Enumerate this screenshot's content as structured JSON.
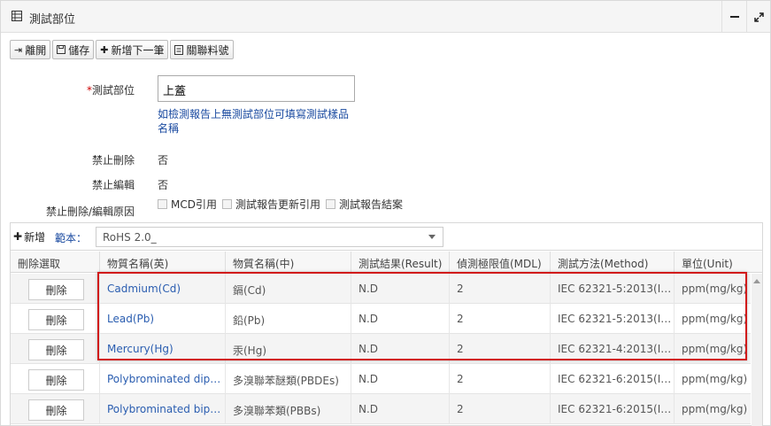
{
  "window": {
    "title": "測試部位",
    "title_icon": "table-icon",
    "minimize_icon": "minimize-icon",
    "maximize_icon": "expand-icon"
  },
  "toolbar": {
    "leave_label": "離開",
    "save_label": "儲存",
    "add_next_label": "新增下一筆",
    "linked_label": "關聯料號"
  },
  "form": {
    "test_part_label": "測試部位",
    "test_part_required_mark": "*",
    "test_part_value": "上蓋",
    "test_part_hint": "如檢測報告上無測試部位可填寫測試樣品名稱",
    "no_delete_label": "禁止刪除",
    "no_delete_value": "否",
    "no_edit_label": "禁止編輯",
    "no_edit_value": "否",
    "reason_label": "禁止刪除/編輯原因",
    "reasons": [
      "MCD引用",
      "測試報告更新引用",
      "測試報告結案"
    ]
  },
  "grid": {
    "add_label": "新增",
    "template_label": "範本：",
    "template_value": "RoHS 2.0_",
    "columns": [
      "刪除選取",
      "物質名稱(英)",
      "物質名稱(中)",
      "測試結果(Result)",
      "偵測極限值(MDL)",
      "測試方法(Method)",
      "單位(Unit)"
    ],
    "delete_label": "刪除",
    "rows": [
      {
        "name_en": "Cadmium(Cd)",
        "name_zh": "鎘(Cd)",
        "result": "N.D",
        "mdl": "2",
        "method": "IEC 62321-5:2013(IC…",
        "unit": "ppm(mg/kg)"
      },
      {
        "name_en": "Lead(Pb)",
        "name_zh": "鉛(Pb)",
        "result": "N.D",
        "mdl": "2",
        "method": "IEC 62321-5:2013(IC…",
        "unit": "ppm(mg/kg)"
      },
      {
        "name_en": "Mercury(Hg)",
        "name_zh": "汞(Hg)",
        "result": "N.D",
        "mdl": "2",
        "method": "IEC 62321-4:2013(IC…",
        "unit": "ppm(mg/kg)"
      },
      {
        "name_en": "Polybrominated diph…",
        "name_zh": "多溴聯苯醚類(PBDEs)",
        "result": "N.D",
        "mdl": "2",
        "method": "IEC 62321-6:2015(IC…",
        "unit": "ppm(mg/kg)"
      },
      {
        "name_en": "Polybrominated biph…",
        "name_zh": "多溴聯苯類(PBBs)",
        "result": "N.D",
        "mdl": "2",
        "method": "IEC 62321-6:2015(IC…",
        "unit": "ppm(mg/kg)"
      }
    ]
  },
  "colors": {
    "highlight": "#d11a1a",
    "link": "#2a5db0",
    "hint": "#1a4aa0"
  }
}
